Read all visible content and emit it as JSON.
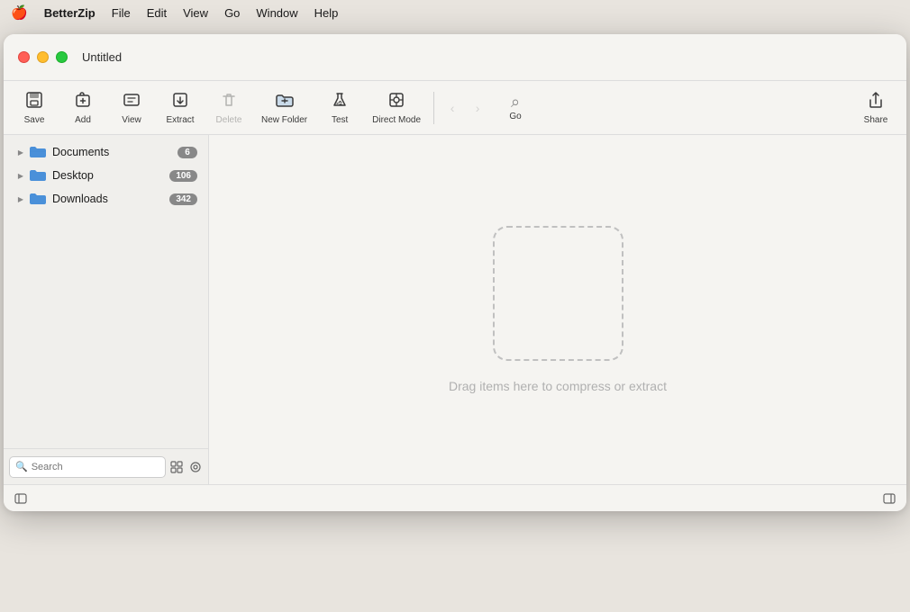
{
  "menubar": {
    "apple": "🍎",
    "app_name": "BetterZip",
    "items": [
      "File",
      "Edit",
      "View",
      "Go",
      "Window",
      "Help"
    ]
  },
  "window": {
    "title": "Untitled"
  },
  "toolbar": {
    "save_label": "Save",
    "add_label": "Add",
    "view_label": "View",
    "extract_label": "Extract",
    "delete_label": "Delete",
    "new_folder_label": "New Folder",
    "test_label": "Test",
    "direct_mode_label": "Direct Mode",
    "go_label": "Go",
    "share_label": "Share"
  },
  "sidebar": {
    "items": [
      {
        "name": "Documents",
        "badge": "6",
        "type": "folder"
      },
      {
        "name": "Desktop",
        "badge": "106",
        "type": "folder"
      },
      {
        "name": "Downloads",
        "badge": "342",
        "type": "folder"
      }
    ]
  },
  "search": {
    "placeholder": "Search"
  },
  "content": {
    "drop_hint": "Drag items here to compress or extract"
  }
}
